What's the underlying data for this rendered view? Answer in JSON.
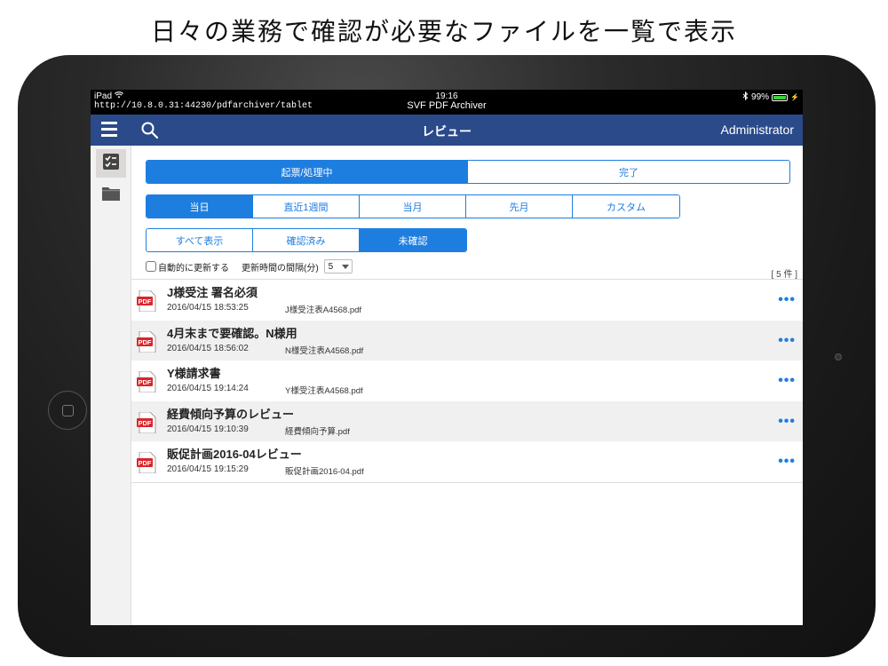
{
  "caption": "日々の業務で確認が必要なファイルを一覧で表示",
  "status_bar": {
    "device": "iPad",
    "url": "http://10.8.0.31:44230/pdfarchiver/tablet",
    "time": "19:16",
    "app_name": "SVF PDF Archiver",
    "battery": "99%"
  },
  "navbar": {
    "title": "レビュー",
    "user": "Administrator"
  },
  "status_tabs": [
    {
      "label": "起票/処理中",
      "selected": true
    },
    {
      "label": "完了",
      "selected": false
    }
  ],
  "period_tabs": [
    {
      "label": "当日",
      "selected": true
    },
    {
      "label": "直近1週間",
      "selected": false
    },
    {
      "label": "当月",
      "selected": false
    },
    {
      "label": "先月",
      "selected": false
    },
    {
      "label": "カスタム",
      "selected": false
    }
  ],
  "filter_tabs": [
    {
      "label": "すべて表示",
      "selected": false
    },
    {
      "label": "確認済み",
      "selected": false
    },
    {
      "label": "未確認",
      "selected": true
    }
  ],
  "auto_update": {
    "label": "自動的に更新する",
    "interval_label": "更新時間の間隔(分)",
    "interval_value": "5"
  },
  "count_label": "[ 5 件 ]",
  "pdf_icon_label": "PDF",
  "more_label": "•••",
  "items": [
    {
      "title": "J様受注 署名必須",
      "date": "2016/04/15 18:53:25",
      "file": "J様受注表A4568.pdf"
    },
    {
      "title": "4月末まで要確認。N様用",
      "date": "2016/04/15 18:56:02",
      "file": "N様受注表A4568.pdf"
    },
    {
      "title": "Y様請求書",
      "date": "2016/04/15 19:14:24",
      "file": "Y様受注表A4568.pdf"
    },
    {
      "title": "経費傾向予算のレビュー",
      "date": "2016/04/15 19:10:39",
      "file": "経費傾向予算.pdf"
    },
    {
      "title": "販促計画2016-04レビュー",
      "date": "2016/04/15 19:15:29",
      "file": "販促計画2016-04.pdf"
    }
  ],
  "colors": {
    "navbar": "#2a4a8a",
    "accent": "#1e7ee0",
    "pdf_red": "#d9262b"
  }
}
